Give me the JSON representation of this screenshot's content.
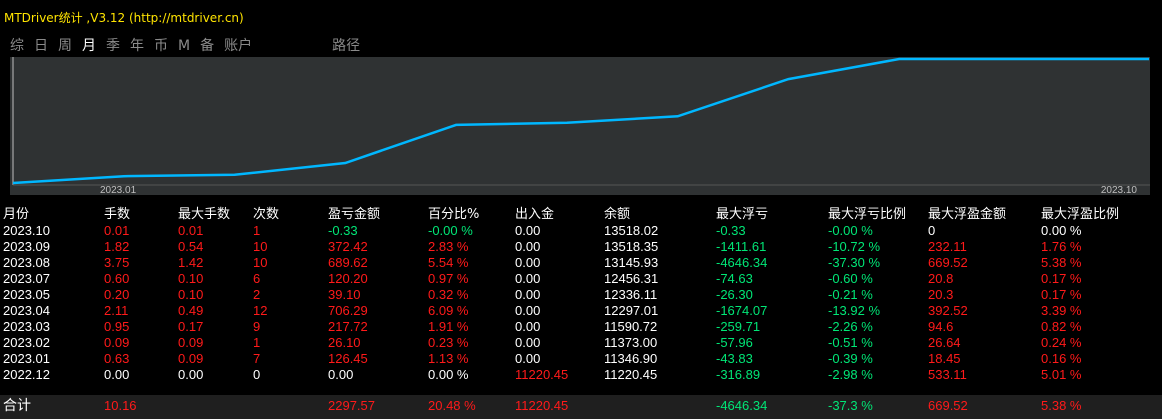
{
  "window": {
    "title": "MTDriver统计 ,V3.12 (http://mtdriver.cn)"
  },
  "tabs": [
    {
      "label": "综",
      "active": false
    },
    {
      "label": "日",
      "active": false
    },
    {
      "label": "周",
      "active": false
    },
    {
      "label": "月",
      "active": true
    },
    {
      "label": "季",
      "active": false
    },
    {
      "label": "年",
      "active": false
    },
    {
      "label": "币",
      "active": false
    },
    {
      "label": "M",
      "active": false
    },
    {
      "label": "备",
      "active": false
    },
    {
      "label": "账户",
      "active": false
    },
    {
      "label": "路径",
      "active": false
    }
  ],
  "chart_data": {
    "type": "line",
    "x_start_label": "2023.01",
    "x_end_label": "2023.10",
    "series": [
      {
        "values": [
          11220.45,
          11346.9,
          11373.0,
          11590.72,
          12297.01,
          12336.11,
          12456.31,
          13145.93,
          13518.35,
          13518.02
        ]
      }
    ],
    "line_color": "#00b7ff"
  },
  "columns": [
    "月份",
    "手数",
    "最大手数",
    "次数",
    "盈亏金额",
    "百分比%",
    "出入金",
    "余额",
    "最大浮亏",
    "最大浮亏比例",
    "最大浮盈金额",
    "最大浮盈比例"
  ],
  "rows": [
    {
      "month": "2023.10",
      "lots": "0.01",
      "max_lots": "0.01",
      "count": "1",
      "pnl": "-0.33",
      "pct": "-0.00 %",
      "flow": "0.00",
      "balance": "13518.02",
      "max_dd": "-0.33",
      "max_dd_pct": "-0.00 %",
      "max_fp": "0",
      "max_fp_pct": "0.00 %"
    },
    {
      "month": "2023.09",
      "lots": "1.82",
      "max_lots": "0.54",
      "count": "10",
      "pnl": "372.42",
      "pct": "2.83 %",
      "flow": "0.00",
      "balance": "13518.35",
      "max_dd": "-1411.61",
      "max_dd_pct": "-10.72 %",
      "max_fp": "232.11",
      "max_fp_pct": "1.76 %"
    },
    {
      "month": "2023.08",
      "lots": "3.75",
      "max_lots": "1.42",
      "count": "10",
      "pnl": "689.62",
      "pct": "5.54 %",
      "flow": "0.00",
      "balance": "13145.93",
      "max_dd": "-4646.34",
      "max_dd_pct": "-37.30 %",
      "max_fp": "669.52",
      "max_fp_pct": "5.38 %"
    },
    {
      "month": "2023.07",
      "lots": "0.60",
      "max_lots": "0.10",
      "count": "6",
      "pnl": "120.20",
      "pct": "0.97 %",
      "flow": "0.00",
      "balance": "12456.31",
      "max_dd": "-74.63",
      "max_dd_pct": "-0.60 %",
      "max_fp": "20.8",
      "max_fp_pct": "0.17 %"
    },
    {
      "month": "2023.05",
      "lots": "0.20",
      "max_lots": "0.10",
      "count": "2",
      "pnl": "39.10",
      "pct": "0.32 %",
      "flow": "0.00",
      "balance": "12336.11",
      "max_dd": "-26.30",
      "max_dd_pct": "-0.21 %",
      "max_fp": "20.3",
      "max_fp_pct": "0.17 %"
    },
    {
      "month": "2023.04",
      "lots": "2.11",
      "max_lots": "0.49",
      "count": "12",
      "pnl": "706.29",
      "pct": "6.09 %",
      "flow": "0.00",
      "balance": "12297.01",
      "max_dd": "-1674.07",
      "max_dd_pct": "-13.92 %",
      "max_fp": "392.52",
      "max_fp_pct": "3.39 %"
    },
    {
      "month": "2023.03",
      "lots": "0.95",
      "max_lots": "0.17",
      "count": "9",
      "pnl": "217.72",
      "pct": "1.91 %",
      "flow": "0.00",
      "balance": "11590.72",
      "max_dd": "-259.71",
      "max_dd_pct": "-2.26 %",
      "max_fp": "94.6",
      "max_fp_pct": "0.82 %"
    },
    {
      "month": "2023.02",
      "lots": "0.09",
      "max_lots": "0.09",
      "count": "1",
      "pnl": "26.10",
      "pct": "0.23 %",
      "flow": "0.00",
      "balance": "11373.00",
      "max_dd": "-57.96",
      "max_dd_pct": "-0.51 %",
      "max_fp": "26.64",
      "max_fp_pct": "0.24 %"
    },
    {
      "month": "2023.01",
      "lots": "0.63",
      "max_lots": "0.09",
      "count": "7",
      "pnl": "126.45",
      "pct": "1.13 %",
      "flow": "0.00",
      "balance": "11346.90",
      "max_dd": "-43.83",
      "max_dd_pct": "-0.39 %",
      "max_fp": "18.45",
      "max_fp_pct": "0.16 %"
    },
    {
      "month": "2022.12",
      "lots": "0.00",
      "max_lots": "0.00",
      "count": "0",
      "pnl": "0.00",
      "pct": "0.00 %",
      "flow": "11220.45",
      "balance": "11220.45",
      "max_dd": "-316.89",
      "max_dd_pct": "-2.98 %",
      "max_fp": "533.11",
      "max_fp_pct": "5.01 %"
    }
  ],
  "totals": {
    "label": "合计",
    "lots": "10.16",
    "pnl": "2297.57",
    "pct": "20.48 %",
    "flow": "11220.45",
    "max_dd": "-4646.34",
    "max_dd_pct": "-37.3 %",
    "max_fp": "669.52",
    "max_fp_pct": "5.38 %"
  },
  "colors": {
    "positive": "#ff1a1a",
    "negative": "#00e676",
    "neutral": "#ffffff",
    "title": "#ffe400"
  }
}
